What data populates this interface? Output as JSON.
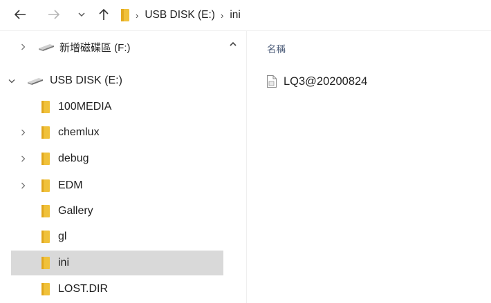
{
  "toolbar": {
    "back_icon": "arrow-left-icon",
    "forward_icon": "arrow-right-icon",
    "recent_icon": "chevron-down-icon",
    "up_icon": "arrow-up-icon"
  },
  "address": {
    "crumbs": [
      "USB DISK (E:)",
      "ini"
    ]
  },
  "nav": {
    "drive_f": "新增磁碟區 (F:)",
    "drive_e": "USB DISK (E:)",
    "folders": [
      "100MEDIA",
      "chemlux",
      "debug",
      "EDM",
      "Gallery",
      "gl",
      "ini",
      "LOST.DIR"
    ],
    "selected": "ini"
  },
  "content": {
    "column_name": "名稱",
    "files": [
      "LQ3@20200824"
    ]
  },
  "colors": {
    "folder": "#f0c13a",
    "selected_bg": "#d9d9d9",
    "header_text": "#4d5d7a"
  }
}
